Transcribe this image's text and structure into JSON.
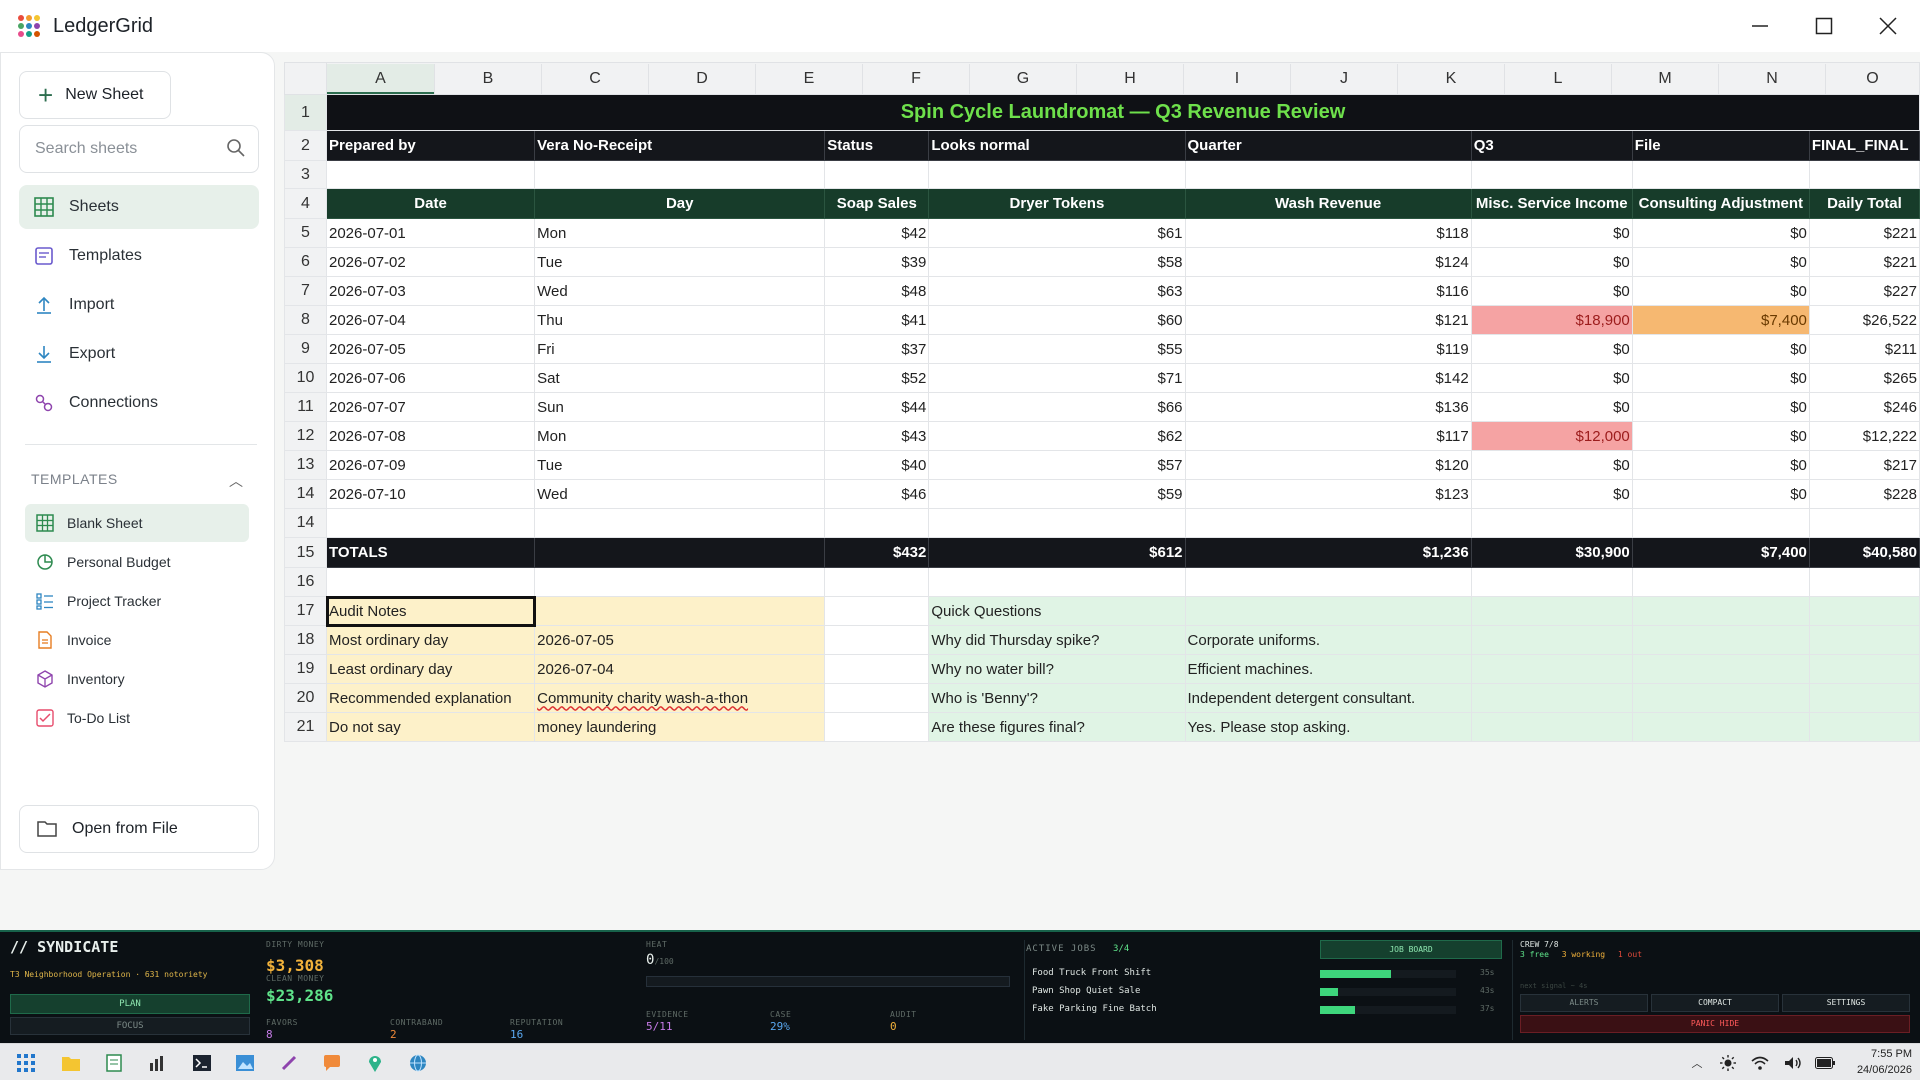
{
  "app": {
    "name": "LedgerGrid"
  },
  "sidebar": {
    "new_sheet": "New Sheet",
    "search_placeholder": "Search sheets",
    "nav": [
      {
        "label": "Sheets",
        "icon": "grid-icon"
      },
      {
        "label": "Templates",
        "icon": "template-icon"
      },
      {
        "label": "Import",
        "icon": "upload-icon"
      },
      {
        "label": "Export",
        "icon": "download-icon"
      },
      {
        "label": "Connections",
        "icon": "link-icon"
      }
    ],
    "templates_heading": "TEMPLATES",
    "templates": [
      {
        "label": "Blank Sheet",
        "icon": "grid-icon"
      },
      {
        "label": "Personal Budget",
        "icon": "pie-icon"
      },
      {
        "label": "Project Tracker",
        "icon": "list-icon"
      },
      {
        "label": "Invoice",
        "icon": "document-icon"
      },
      {
        "label": "Inventory",
        "icon": "box-icon"
      },
      {
        "label": "To-Do List",
        "icon": "checklist-icon"
      }
    ],
    "open_file": "Open from File"
  },
  "sheet": {
    "columns": [
      "A",
      "B",
      "C",
      "D",
      "E",
      "F",
      "G",
      "H",
      "I",
      "J",
      "K",
      "L",
      "M",
      "N",
      "O"
    ],
    "rows": [
      "1",
      "2",
      "3",
      "4",
      "5",
      "6",
      "7",
      "8",
      "9",
      "10",
      "11",
      "12",
      "13",
      "14",
      "15",
      "16",
      "17",
      "18",
      "19",
      "20",
      "21"
    ],
    "title": "Spin Cycle Laundromat — Q3 Revenue Review",
    "meta": {
      "prepared_by": "Prepared by",
      "preparer": "Vera No-Receipt",
      "status": "Status",
      "status_value": "Looks normal",
      "quarter": "Quarter",
      "quarter_value": "Q3",
      "file": "File",
      "file_value": "FINAL_FINAL"
    },
    "headers": [
      "Date",
      "Day",
      "Soap Sales",
      "Dryer Tokens",
      "Wash Revenue",
      "Misc. Service Income",
      "Consulting Adjustment",
      "Daily Total"
    ],
    "data": [
      [
        "2026-07-01",
        "Mon",
        "$42",
        "$61",
        "$118",
        "$0",
        "$0",
        "$221"
      ],
      [
        "2026-07-02",
        "Tue",
        "$39",
        "$58",
        "$124",
        "$0",
        "$0",
        "$221"
      ],
      [
        "2026-07-03",
        "Wed",
        "$48",
        "$63",
        "$116",
        "$0",
        "$0",
        "$227"
      ],
      [
        "2026-07-04",
        "Thu",
        "$41",
        "$60",
        "$121",
        "$18,900",
        "$7,400",
        "$26,522"
      ],
      [
        "2026-07-05",
        "Fri",
        "$37",
        "$55",
        "$119",
        "$0",
        "$0",
        "$211"
      ],
      [
        "2026-07-06",
        "Sat",
        "$52",
        "$71",
        "$142",
        "$0",
        "$0",
        "$265"
      ],
      [
        "2026-07-07",
        "Sun",
        "$44",
        "$66",
        "$136",
        "$0",
        "$0",
        "$246"
      ],
      [
        "2026-07-08",
        "Mon",
        "$43",
        "$62",
        "$117",
        "$12,000",
        "$0",
        "$12,222"
      ],
      [
        "2026-07-09",
        "Tue",
        "$40",
        "$57",
        "$120",
        "$0",
        "$0",
        "$217"
      ],
      [
        "2026-07-10",
        "Wed",
        "$46",
        "$59",
        "$123",
        "$0",
        "$0",
        "$228"
      ]
    ],
    "totals": [
      "TOTALS",
      "",
      "$432",
      "$612",
      "$1,236",
      "$30,900",
      "$7,400",
      "$40,580"
    ],
    "audit": {
      "heading": "Audit Notes",
      "rows": [
        [
          "Most ordinary day",
          "2026-07-05"
        ],
        [
          "Least ordinary day",
          "2026-07-04"
        ],
        [
          "Recommended explanation",
          "Community charity wash-a-thon"
        ],
        [
          "Do not say",
          "money laundering"
        ]
      ]
    },
    "questions": {
      "heading": "Quick Questions",
      "rows": [
        [
          "Why did Thursday spike?",
          "Corporate uniforms."
        ],
        [
          "Why no water bill?",
          "Efficient machines."
        ],
        [
          "Who is 'Benny'?",
          "Independent detergent consultant."
        ],
        [
          "Are these figures final?",
          "Yes. Please stop asking."
        ]
      ]
    },
    "colors": {
      "red": "#f5a3a3",
      "orange": "#f6b871",
      "title_green": "#6ee04b",
      "header_green": "#173c2a"
    }
  },
  "game": {
    "title": "// SYNDICATE",
    "operation": "T3 Neighborhood Operation · 631 notoriety",
    "plan": "PLAN",
    "focus": "FOCUS",
    "dirty_money_label": "DIRTY MONEY",
    "dirty_money": "$3,308",
    "clean_money_label": "CLEAN MONEY",
    "clean_money": "$23,286",
    "favors_label": "FAVORS",
    "favors": "8",
    "contraband_label": "CONTRABAND",
    "contraband": "2",
    "reputation_label": "REPUTATION",
    "reputation": "16",
    "heat_label": "HEAT",
    "heat": "0",
    "heat_max": "/100",
    "heat_value": 0,
    "evidence_label": "EVIDENCE",
    "evidence": "5/11",
    "case_label": "CASE",
    "case": "29%",
    "audit_label": "AUDIT",
    "audit": "0",
    "active_jobs_label": "ACTIVE JOBS",
    "active_jobs": "3/4",
    "job_board": "JOB BOARD",
    "jobs": [
      {
        "name": "Food Truck Front Shift",
        "time": "35s",
        "progress": 0.52
      },
      {
        "name": "Pawn Shop Quiet Sale",
        "time": "43s",
        "progress": 0.13
      },
      {
        "name": "Fake Parking Fine Batch",
        "time": "37s",
        "progress": 0.26
      }
    ],
    "crew_label": "CREW 7/8",
    "crew_free": "3 free",
    "crew_working": "3 working",
    "crew_out": "1 out",
    "next_signal": "next signal ~ 4s",
    "alerts": "ALERTS",
    "compact": "COMPACT",
    "settings": "SETTINGS",
    "panic": "PANIC HIDE"
  },
  "taskbar": {
    "time": "7:55 PM",
    "date": "24/06/2026"
  }
}
